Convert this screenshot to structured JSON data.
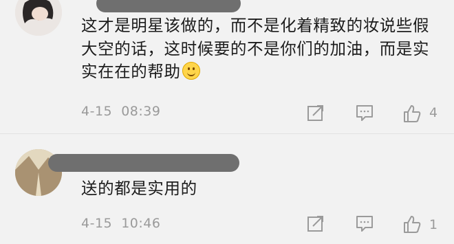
{
  "comments": [
    {
      "text": "这才是明星该做的，而不是化着精致的妆说些假大空的话，这时候要的不是你们的加油，而是实实在在的帮助",
      "emoji": "smile-emoji",
      "date": "4-15",
      "time": "08:39",
      "likes": "4"
    },
    {
      "text": "送的都是实用的",
      "date": "4-15",
      "time": "10:46",
      "likes": "1"
    }
  ],
  "icons": [
    "share-icon",
    "reply-icon",
    "like-icon"
  ]
}
